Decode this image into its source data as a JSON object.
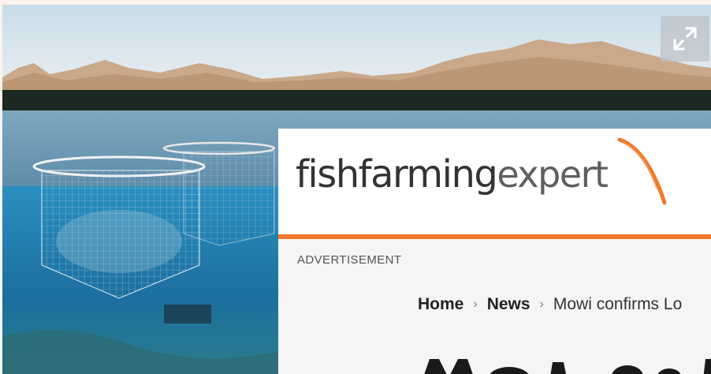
{
  "hero": {
    "expand_icon": "expand-icon"
  },
  "site": {
    "logo_bold": "fishfarming",
    "logo_light": "expert",
    "accent_color": "#f0792b"
  },
  "advertisement_label": "ADVERTISEMENT",
  "breadcrumb": {
    "home": "Home",
    "news": "News",
    "current": "Mowi confirms Lo",
    "separator_icon": "chevron-right-icon"
  }
}
